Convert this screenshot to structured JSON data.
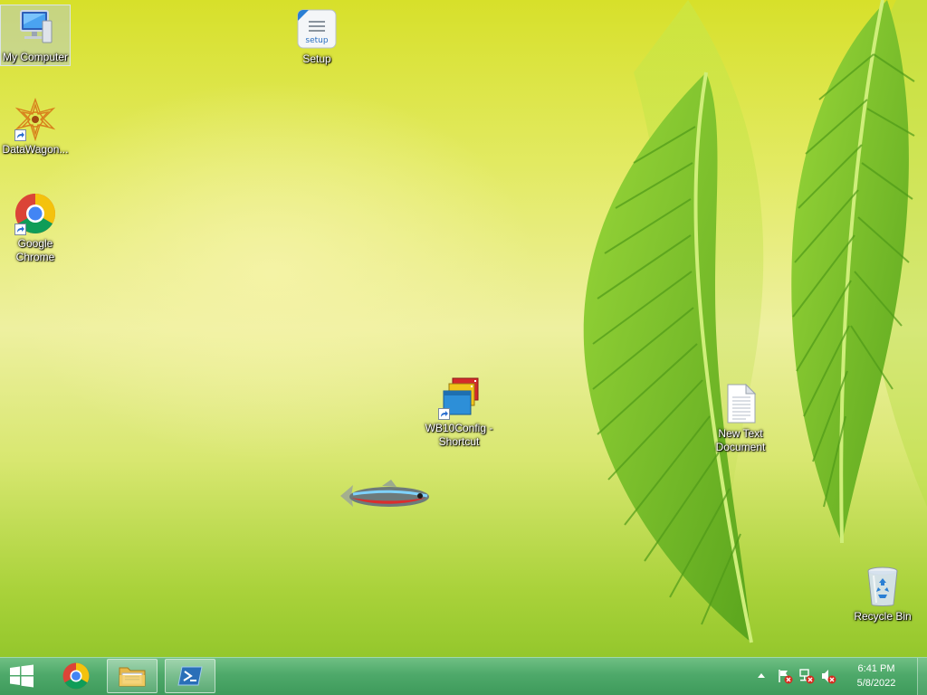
{
  "desktop": {
    "icons": [
      {
        "label": "My Computer"
      },
      {
        "label": "Setup"
      },
      {
        "label": "DataWagon..."
      },
      {
        "label": "Google Chrome"
      },
      {
        "label": "WB10Config - Shortcut"
      },
      {
        "label": "New Text Document"
      },
      {
        "label": "Recycle Bin"
      }
    ],
    "setup_icon_text": "setup"
  },
  "taskbar": {
    "clock_time": "6:41 PM",
    "clock_date": "5/8/2022"
  },
  "colors": {
    "taskbar": "#4ea96a",
    "leaf": "#7cc52a",
    "chrome_red": "#db4437",
    "chrome_yellow": "#f4c20d",
    "chrome_green": "#0f9d58",
    "chrome_blue": "#4285f4"
  }
}
